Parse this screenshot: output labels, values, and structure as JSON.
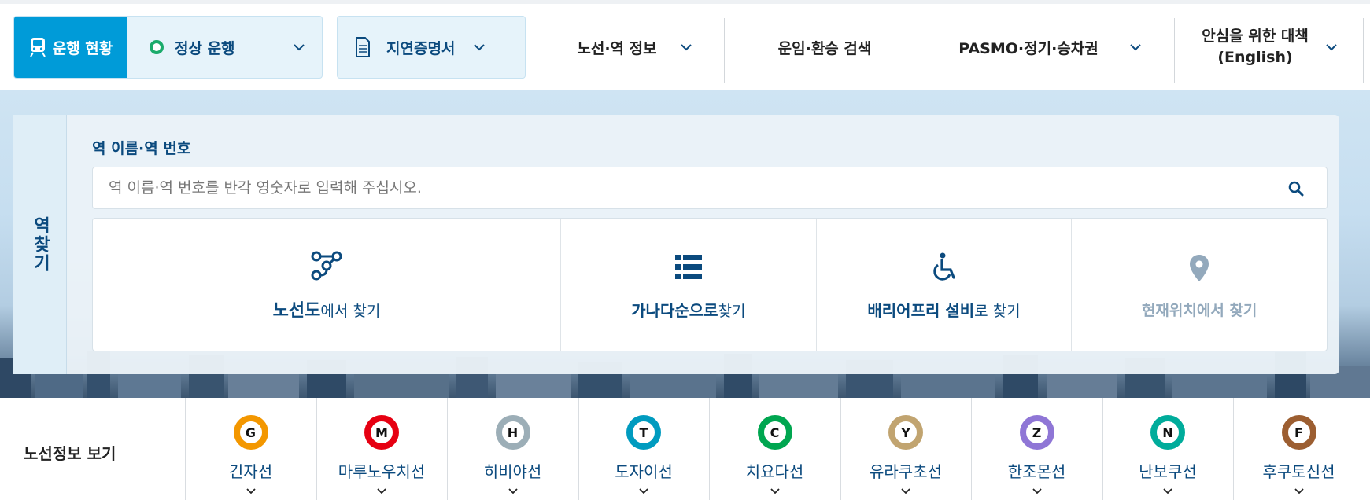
{
  "header": {
    "status_label": "운행 현황",
    "status_value": "정상 운행",
    "certificate": "지연증명서",
    "nav": [
      {
        "label": "노선·역 정보"
      },
      {
        "label": "운임·환승 검색"
      },
      {
        "label": "PASMO·정기·승차권"
      },
      {
        "label": "안심을 위한 대책",
        "sub": "(English)"
      }
    ]
  },
  "search": {
    "side_tab": "역찾기",
    "label": "역 이름·역 번호",
    "placeholder": "역 이름·역 번호를 반각 영숫자로 입력해 주십시오.",
    "options": [
      {
        "bold": "노선도",
        "rest": "에서 찾기"
      },
      {
        "bold": "가나다순으로",
        "rest": "찾기"
      },
      {
        "bold": "배리어프리 설비",
        "rest": "로 찾기"
      },
      {
        "bold": "현재위치에서 찾기",
        "rest": ""
      }
    ]
  },
  "lines_section": {
    "title": "노선정보 보기",
    "lines": [
      {
        "letter": "G",
        "name": "긴자선",
        "color": "#f39700"
      },
      {
        "letter": "M",
        "name": "마루노우치선",
        "color": "#e60012"
      },
      {
        "letter": "H",
        "name": "히비야선",
        "color": "#9caeb7"
      },
      {
        "letter": "T",
        "name": "도자이선",
        "color": "#009bbf"
      },
      {
        "letter": "C",
        "name": "치요다선",
        "color": "#00a650"
      },
      {
        "letter": "Y",
        "name": "유라쿠초선",
        "color": "#c1a470"
      },
      {
        "letter": "Z",
        "name": "한조몬선",
        "color": "#8f76d6"
      },
      {
        "letter": "N",
        "name": "난보쿠선",
        "color": "#00ac9b"
      },
      {
        "letter": "F",
        "name": "후쿠토신선",
        "color": "#9c5e31"
      }
    ]
  },
  "colors": {
    "primary": "#009bd8",
    "navy": "#0b4a7e",
    "ok": "#1bab6b"
  }
}
